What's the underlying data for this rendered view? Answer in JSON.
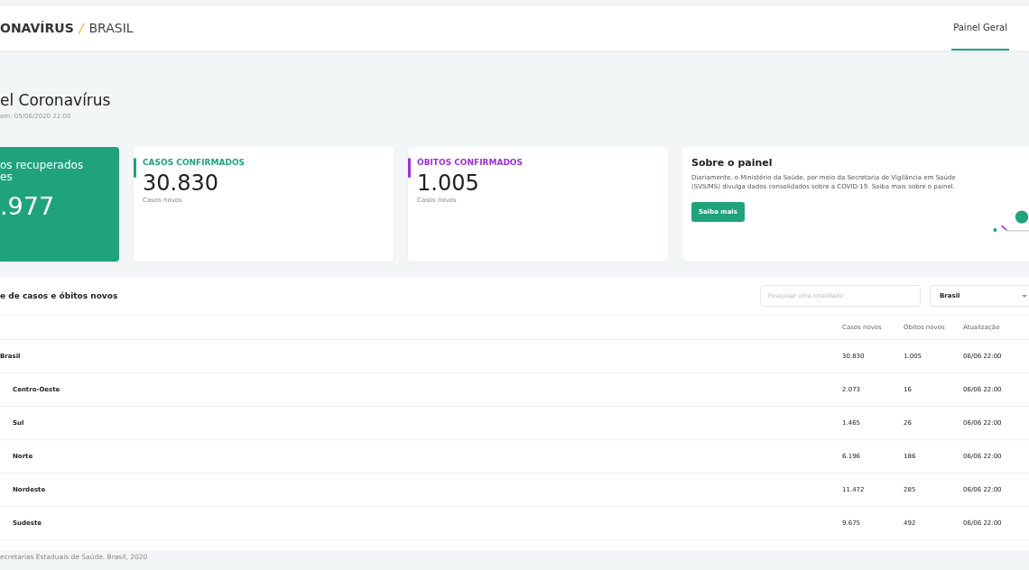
{
  "header": {
    "logo_bold": "ONAVÍRUS",
    "logo_sep": "/",
    "logo_light": "BRASIL",
    "nav": [
      {
        "label": "Painel Geral",
        "selected": true
      }
    ]
  },
  "page": {
    "title": "el Coronavírus",
    "updated": "em: 05/06/2020 22:00"
  },
  "cards": [
    {
      "kind": "highlight",
      "title": "os recuperados",
      "title_2": "es",
      "value": ".977"
    },
    {
      "kind": "stat",
      "title": "CASOS CONFIRMADOS",
      "value": "30.830",
      "caption": "Casos novos",
      "color": "#1fa37c"
    },
    {
      "kind": "stat",
      "title": "ÓBITOS CONFIRMADOS",
      "value": "1.005",
      "caption": "Casos novos",
      "color": "#9b30d9"
    },
    {
      "kind": "info",
      "title": "Sobre o painel",
      "text": "Diariamente, o Ministério da Saúde, por meio da Secretaria de Vigilância em Saúde (SVS/MS) divulga dados consolidados sobre a COVID-19. Saiba mais sobre o painel.",
      "button": "Saiba mais"
    }
  ],
  "table": {
    "title": "e de casos e óbitos novos",
    "search": {
      "placeholder": "Pesquisar uma localidade"
    },
    "select": {
      "value": "Brasil"
    },
    "columns": [
      "Casos novos",
      "Óbitos novos",
      "Atualização"
    ],
    "rows": [
      {
        "name": "Brasil",
        "kind": "country",
        "values": [
          "30.830",
          "1.005",
          "06/06 22:00"
        ]
      },
      {
        "name": "Centro-Oeste",
        "kind": "region",
        "values": [
          "2.073",
          "16",
          "06/06 22:00"
        ]
      },
      {
        "name": "Sul",
        "kind": "region",
        "values": [
          "1.465",
          "26",
          "06/06 22:00"
        ]
      },
      {
        "name": "Norte",
        "kind": "region",
        "values": [
          "6.196",
          "186",
          "06/06 22:00"
        ]
      },
      {
        "name": "Nordeste",
        "kind": "region",
        "values": [
          "11.472",
          "285",
          "06/06 22:00"
        ]
      },
      {
        "name": "Sudeste",
        "kind": "region",
        "values": [
          "9.675",
          "492",
          "06/06 22:00"
        ]
      }
    ]
  },
  "footer": {
    "source": "ecretarias Estaduais de Saúde. Brasil, 2020"
  }
}
